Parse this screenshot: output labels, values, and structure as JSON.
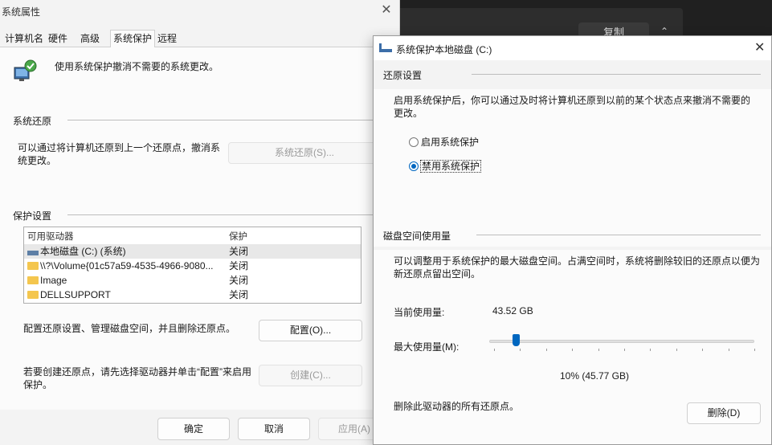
{
  "background_app": {
    "copy_button": "复制",
    "chevron": "⌃"
  },
  "sysprops": {
    "title": "系统属性",
    "close": "✕",
    "tabs": [
      "计算机名",
      "硬件",
      "高级",
      "系统保护",
      "远程"
    ],
    "active_tab": "系统保护",
    "intro": "使用系统保护撤消不需要的系统更改。",
    "restore_section": "系统还原",
    "restore_text": "可以通过将计算机还原到上一个还原点，撤消系统更改。",
    "restore_button": "系统还原(S)...",
    "protection_section": "保护设置",
    "list": {
      "headers": [
        "可用驱动器",
        "保护"
      ],
      "rows": [
        {
          "name": "本地磁盘 (C:) (系统)",
          "protection": "关闭",
          "icon": "drive-icon"
        },
        {
          "name": "\\\\?\\Volume{01c57a59-4535-4966-9080...",
          "protection": "关闭",
          "icon": "folder-icon"
        },
        {
          "name": "Image",
          "protection": "关闭",
          "icon": "folder-icon"
        },
        {
          "name": "DELLSUPPORT",
          "protection": "关闭",
          "icon": "folder-icon"
        }
      ]
    },
    "config_text": "配置还原设置、管理磁盘空间，并且删除还原点。",
    "config_button": "配置(O)...",
    "create_text": "若要创建还原点，请先选择驱动器并单击“配置”来启用保护。",
    "create_button": "创建(C)...",
    "ok": "确定",
    "cancel": "取消",
    "apply": "应用(A)"
  },
  "dialog": {
    "title": "系统保护本地磁盘 (C:)",
    "close": "✕",
    "restore_settings_section": "还原设置",
    "restore_desc": "启用系统保护后，你可以通过及时将计算机还原到以前的某个状态点来撤消不需要的更改。",
    "radio_enable": "启用系统保护",
    "radio_disable": "禁用系统保护",
    "selected_radio": "disable",
    "disk_usage_section": "磁盘空间使用量",
    "disk_desc": "可以调整用于系统保护的最大磁盘空间。占满空间时，系统将删除较旧的还原点以便为新还原点留出空间。",
    "current_usage_label": "当前使用量:",
    "current_usage_value": "43.52 GB",
    "max_usage_label": "最大使用量(M):",
    "max_usage_percent": 0.1,
    "max_usage_text": "10% (45.77 GB)",
    "delete_text": "删除此驱动器的所有还原点。",
    "delete_button": "删除(D)"
  }
}
